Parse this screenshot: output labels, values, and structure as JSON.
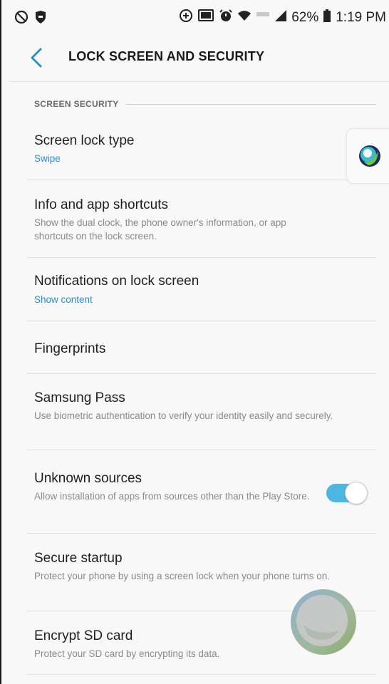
{
  "status_bar": {
    "battery": "62%",
    "time": "1:19 PM",
    "left_icons": [
      "block-icon",
      "shield-icon"
    ],
    "right_icons": [
      "data-saver-icon",
      "cast-icon",
      "alarm-icon",
      "wifi-icon",
      "lte-icon",
      "signal-icon",
      "battery-icon"
    ]
  },
  "header": {
    "title": "LOCK SCREEN AND SECURITY",
    "back_icon": "back-arrow-icon"
  },
  "section": {
    "title": "SCREEN SECURITY"
  },
  "items": [
    {
      "title": "Screen lock type",
      "subtitle": "Swipe"
    },
    {
      "title": "Info and app shortcuts",
      "subtitle": "Show the dual clock, the phone owner's information, or app shortcuts on the lock screen."
    },
    {
      "title": "Notifications on lock screen",
      "subtitle": "Show content"
    },
    {
      "title": "Fingerprints"
    },
    {
      "title": "Samsung Pass",
      "subtitle": "Use biometric authentication to verify your identity easily and securely."
    },
    {
      "title": "Unknown sources",
      "subtitle": "Allow installation of apps from sources other than the Play Store.",
      "toggle_on": true
    },
    {
      "title": "Secure startup",
      "subtitle": "Protect your phone by using a screen lock when your phone turns on."
    },
    {
      "title": "Encrypt SD card",
      "subtitle": "Protect your SD card by encrypting its data."
    }
  ],
  "colors": {
    "accent": "#2f8fc4",
    "toggle_on": "#4db6e1",
    "background": "#f8f8f8"
  }
}
